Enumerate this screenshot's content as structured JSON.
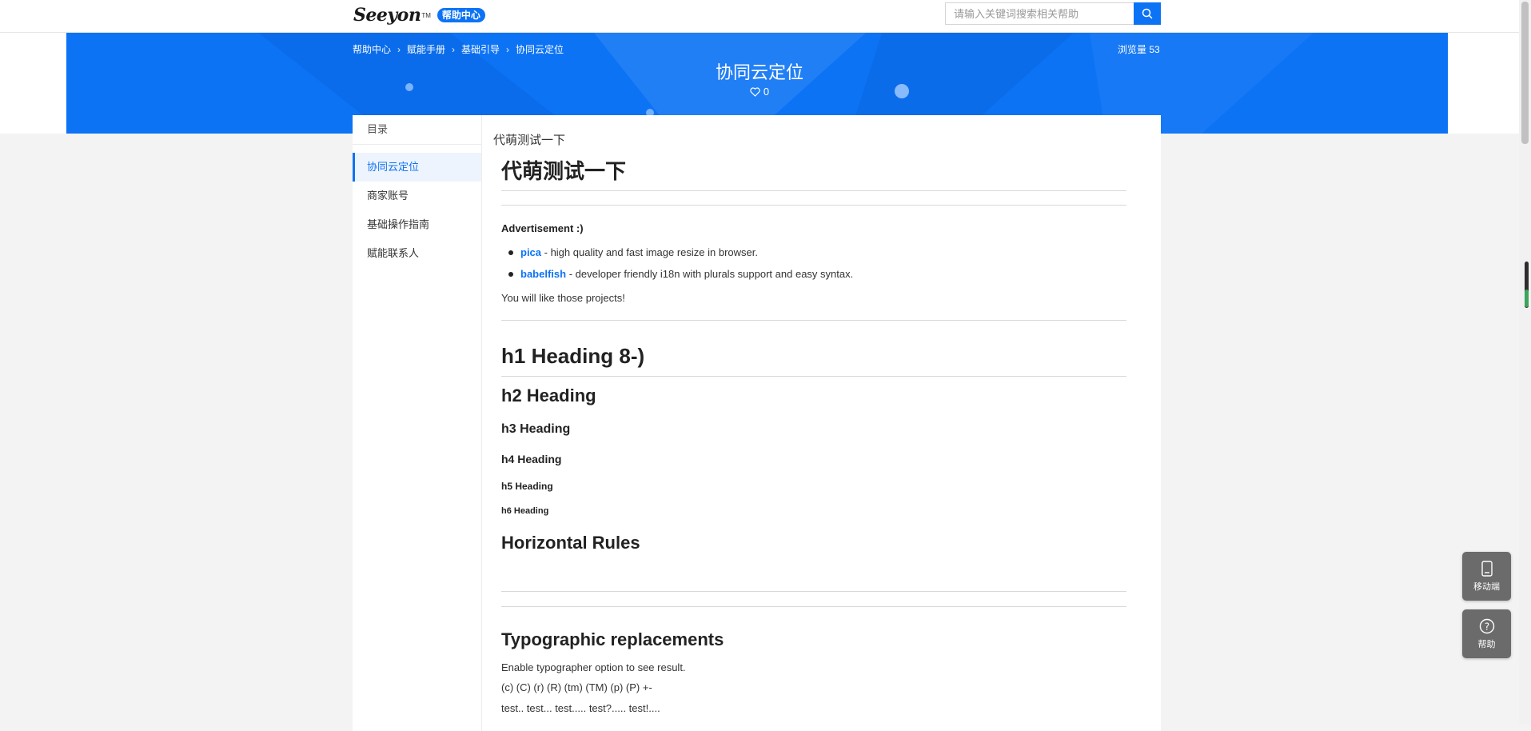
{
  "header": {
    "logo_text": "Seeyon",
    "logo_tm": "TM",
    "badge": "帮助中心",
    "search_placeholder": "请输入关键词搜索相关帮助",
    "search_icon": "search-icon"
  },
  "banner": {
    "breadcrumb": [
      "帮助中心",
      "赋能手册",
      "基础引导",
      "协同云定位"
    ],
    "views": "浏览量 53",
    "title": "协同云定位",
    "likes": "0",
    "accent_color": "#0d73f5"
  },
  "toc": {
    "title": "目录",
    "items": [
      "协同云定位",
      "商家账号",
      "基础操作指南",
      "赋能联系人"
    ]
  },
  "article": {
    "doc_title": "代萌测试一下",
    "h1": "代萌测试一下",
    "ad_title": "Advertisement :)",
    "list": [
      {
        "link": "pica",
        "text": " - high quality and fast image resize in browser."
      },
      {
        "link": "babelfish",
        "text": " - developer friendly i18n with plurals support and easy syntax."
      }
    ],
    "like_text": "You will like those projects!",
    "h1_heading": "h1 Heading 8-)",
    "h2_heading": "h2 Heading",
    "h3_heading": "h3 Heading",
    "h4_heading": "h4 Heading",
    "h5_heading": "h5 Heading",
    "h6_heading": "h6 Heading",
    "hr_heading": "Horizontal Rules",
    "typo_heading": "Typographic replacements",
    "typo_text": "Enable typographer option to see result.",
    "typo_line1": "(c) (C) (r) (R) (tm) (TM) (p) (P) +-",
    "typo_line2": "test.. test... test..... test?..... test!...."
  },
  "float": {
    "mobile_label": "移动端",
    "help_label": "帮助"
  }
}
